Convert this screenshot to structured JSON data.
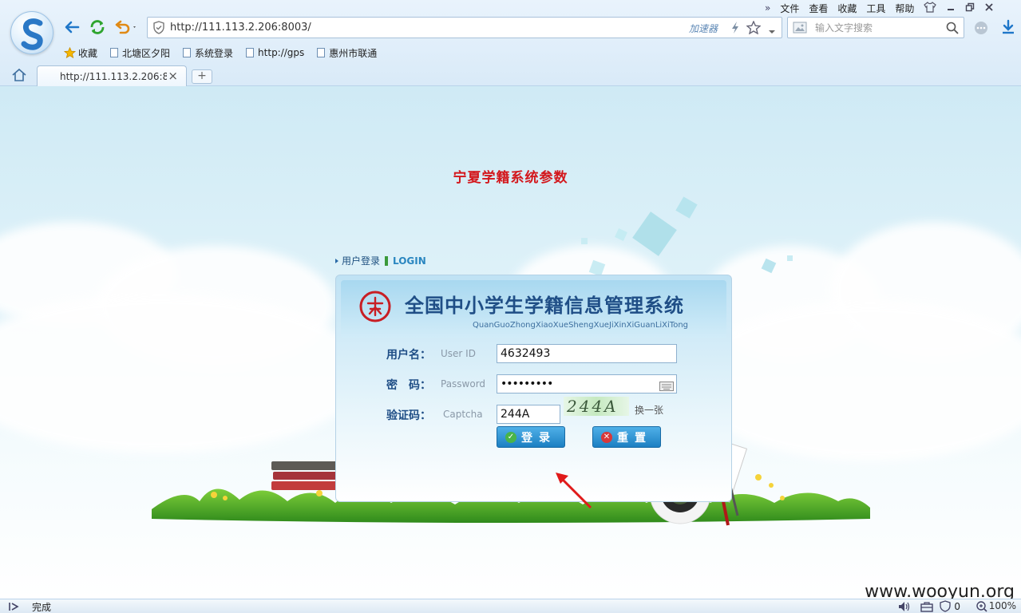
{
  "browser": {
    "menu": [
      "文件",
      "查看",
      "收藏",
      "工具",
      "帮助"
    ],
    "address": "http://111.113.2.206:8003/",
    "accelerator_label": "加速器",
    "search_placeholder": "输入文字搜索",
    "bookmarks": [
      {
        "label": "收藏",
        "icon": "star-icon"
      },
      {
        "label": "北塘区夕阳",
        "icon": "page-icon"
      },
      {
        "label": "系统登录",
        "icon": "page-icon"
      },
      {
        "label": "http://gps",
        "icon": "page-icon"
      },
      {
        "label": "惠州市联通",
        "icon": "page-icon"
      }
    ],
    "tab_title": "http://111.113.2.206:8",
    "status": "完成",
    "zoom": "100%",
    "status_count": "0"
  },
  "page": {
    "title": "宁夏学籍系统参数",
    "login_label": "用户登录",
    "login_en": "LOGIN",
    "system_title": "全国中小学生学籍信息管理系统",
    "system_pinyin": "QuanGuoZhongXiaoXueShengXueJiXinXiGuanLiXiTong",
    "form": {
      "username_label": "用户名：",
      "username_hint": "User ID",
      "username_value": "4632493",
      "password_label": "密　码：",
      "password_hint": "Password",
      "password_value": "•••••••••",
      "captcha_label": "验证码：",
      "captcha_hint": "Captcha",
      "captcha_value": "244A",
      "captcha_image_text": "244A",
      "captcha_refresh": "换一张",
      "login_button": "登录",
      "reset_button": "重置"
    },
    "watermark": "www.wooyun.org"
  },
  "colors": {
    "title_red": "#d3171c",
    "brand_blue": "#1f4e86",
    "button_blue": "#1c7fc2"
  }
}
